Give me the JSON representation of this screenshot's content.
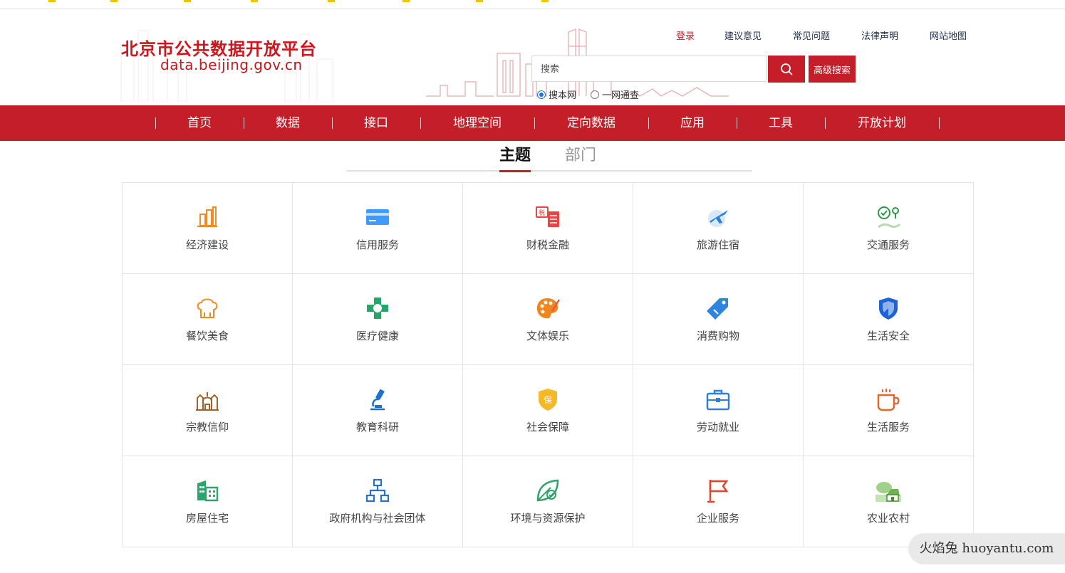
{
  "header": {
    "title": "北京市公共数据开放平台",
    "domain": "data.beijing.gov.cn"
  },
  "toplinks": [
    "登录",
    "建议意见",
    "常见问题",
    "法律声明",
    "网站地图"
  ],
  "search": {
    "placeholder": "搜索",
    "button_icon": "search-icon",
    "advanced_label": "高级搜索",
    "scope_options": [
      "搜本网",
      "一网通查"
    ],
    "scope_selected": "搜本网"
  },
  "nav": [
    "首页",
    "数据",
    "接口",
    "地理空间",
    "定向数据",
    "应用",
    "工具",
    "开放计划"
  ],
  "tabs": [
    "主题",
    "部门"
  ],
  "tabs_active": "主题",
  "topics": [
    {
      "label": "经济建设",
      "icon": "building-chart-icon"
    },
    {
      "label": "信用服务",
      "icon": "credit-card-icon"
    },
    {
      "label": "财税金融",
      "icon": "tax-document-icon"
    },
    {
      "label": "旅游住宿",
      "icon": "airplane-globe-icon"
    },
    {
      "label": "交通服务",
      "icon": "map-pin-check-icon"
    },
    {
      "label": "餐饮美食",
      "icon": "chef-hat-icon"
    },
    {
      "label": "医疗健康",
      "icon": "medical-cross-icon"
    },
    {
      "label": "文体娱乐",
      "icon": "palette-icon"
    },
    {
      "label": "消费购物",
      "icon": "price-tag-icon"
    },
    {
      "label": "生活安全",
      "icon": "shield-icon"
    },
    {
      "label": "宗教信仰",
      "icon": "temple-icon"
    },
    {
      "label": "教育科研",
      "icon": "microscope-icon"
    },
    {
      "label": "社会保障",
      "icon": "insurance-shield-icon"
    },
    {
      "label": "劳动就业",
      "icon": "briefcase-icon"
    },
    {
      "label": "生活服务",
      "icon": "coffee-cup-icon"
    },
    {
      "label": "房屋住宅",
      "icon": "residential-building-icon"
    },
    {
      "label": "政府机构与社会团体",
      "icon": "org-chart-icon"
    },
    {
      "label": "环境与资源保护",
      "icon": "eco-leaf-icon"
    },
    {
      "label": "企业服务",
      "icon": "flag-icon"
    },
    {
      "label": "农业农村",
      "icon": "farmhouse-icon"
    }
  ],
  "watermark": "火焰兔 huoyantu.com",
  "colors": {
    "brand_red": "#c41e29",
    "link_dark": "#1f2f4f",
    "grid_border": "#e3e3e3"
  }
}
